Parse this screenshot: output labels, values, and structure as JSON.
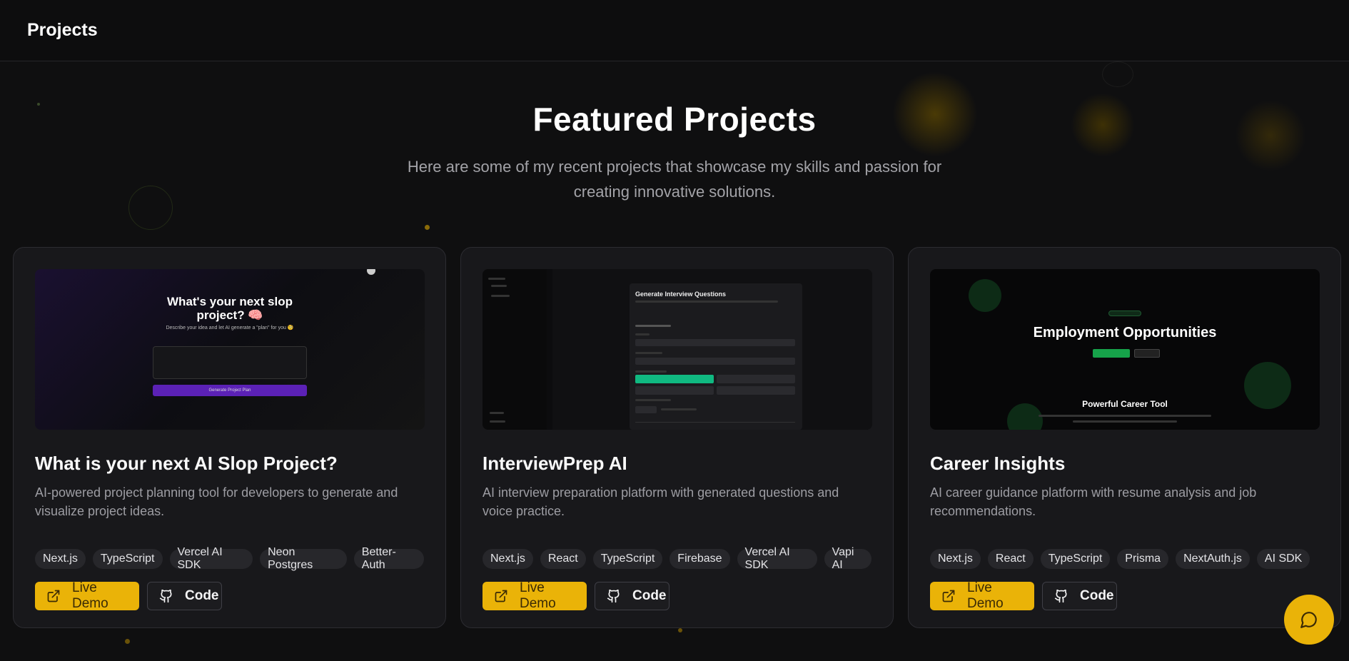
{
  "header": {
    "title": "Projects"
  },
  "hero": {
    "title": "Featured Projects",
    "subtitle": "Here are some of my recent projects that showcase my skills and passion for creating innovative solutions."
  },
  "colors": {
    "accent": "#eab308",
    "background": "#0f0f10",
    "card": "#18181b",
    "tag": "#27272b"
  },
  "projects": [
    {
      "title": "What is your next AI Slop Project?",
      "description": "AI-powered project planning tool for developers to generate and visualize project ideas.",
      "tags": [
        "Next.js",
        "TypeScript",
        "Vercel AI SDK",
        "Neon Postgres",
        "Better-Auth"
      ],
      "demo_label": "Live Demo",
      "code_label": "Code",
      "preview": {
        "heading": "What's your next slop project? 🧠",
        "subtext": "Describe your idea and let AI generate a \"plan\" for you 🧐",
        "button": "Generate Project Plan"
      }
    },
    {
      "title": "InterviewPrep AI",
      "description": "AI interview preparation platform with generated questions and voice practice.",
      "tags": [
        "Next.js",
        "React",
        "TypeScript",
        "Firebase",
        "Vercel AI SDK",
        "Vapi AI"
      ],
      "demo_label": "Live Demo",
      "code_label": "Code",
      "preview": {
        "heading": "Generate Interview Questions"
      }
    },
    {
      "title": "Career Insights",
      "description": "AI career guidance platform with resume analysis and job recommendations.",
      "tags": [
        "Next.js",
        "React",
        "TypeScript",
        "Prisma",
        "NextAuth.js",
        "AI SDK"
      ],
      "demo_label": "Live Demo",
      "code_label": "Code",
      "preview": {
        "heading": "Employment Opportunities",
        "subheading": "Powerful Career Tool"
      }
    }
  ],
  "icons": {
    "demo": "external-link-icon",
    "code": "github-icon",
    "chat": "chat-bubble-icon"
  }
}
